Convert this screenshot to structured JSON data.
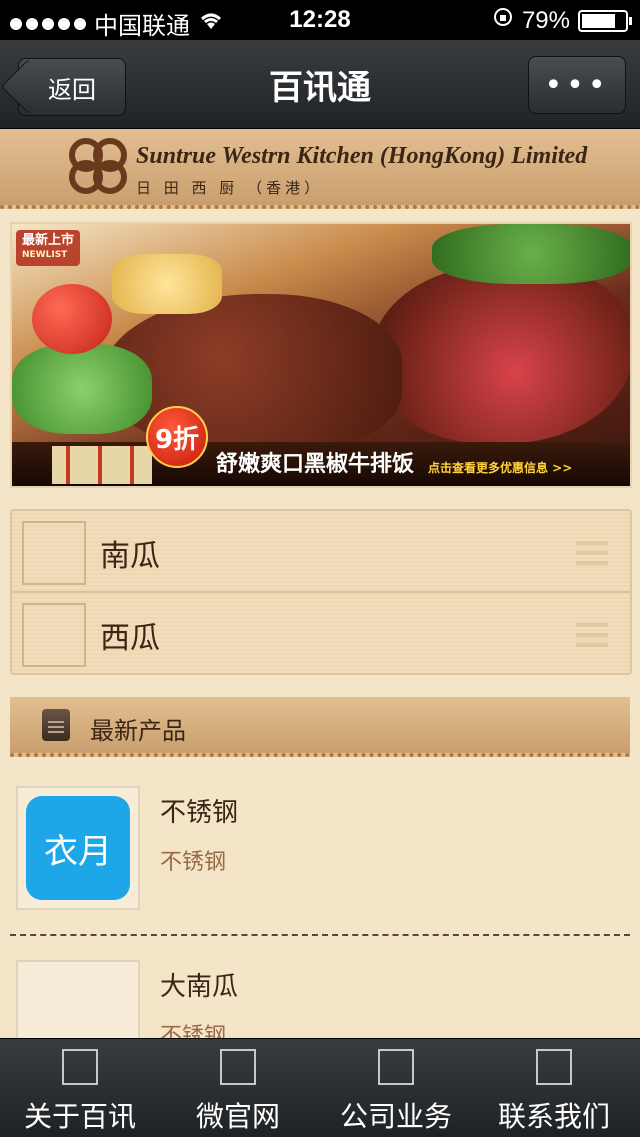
{
  "status_bar": {
    "carrier": "中国联通",
    "time": "12:28",
    "battery": "79%",
    "battery_level": 0.79
  },
  "nav": {
    "back_label": "返回",
    "title": "百讯通",
    "more_label": "•••"
  },
  "brand": {
    "name_en": "Suntrue Westrn Kitchen (HongKong) Limited",
    "name_cn": "日 田 西 厨 （香港）"
  },
  "banner": {
    "tag": "最新上市",
    "tag_sub": "NEWLIST",
    "discount": "9折",
    "title": "舒嫩爽口黑椒牛排饭",
    "link": "点击查看更多优惠信息 >>"
  },
  "list": {
    "items": [
      {
        "label": "南瓜"
      },
      {
        "label": "西瓜"
      }
    ]
  },
  "section": {
    "title": "最新产品"
  },
  "products": [
    {
      "name": "不锈钢",
      "subtitle": "不锈钢",
      "icon_text": "衣月",
      "icon_color": "#1ea7e8"
    },
    {
      "name": "大南瓜",
      "subtitle": "不锈钢"
    }
  ],
  "tabbar": {
    "tabs": [
      {
        "label": "关于百讯"
      },
      {
        "label": "微官网"
      },
      {
        "label": "公司业务"
      },
      {
        "label": "联系我们"
      }
    ]
  }
}
